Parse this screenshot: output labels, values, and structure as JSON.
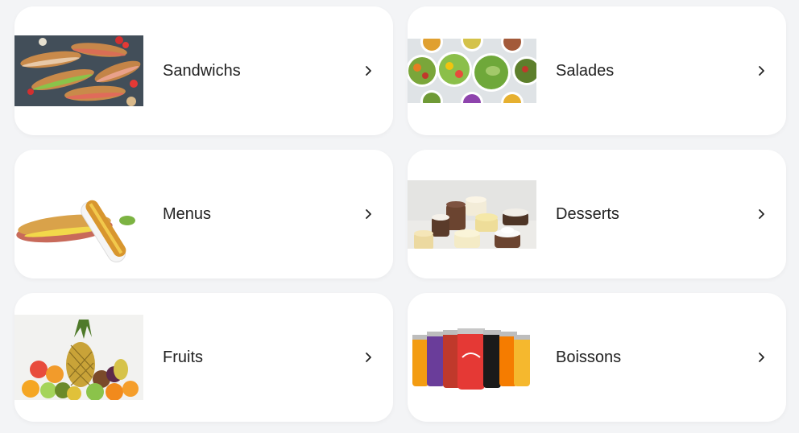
{
  "categories": [
    {
      "label": "Sandwichs",
      "image": "sandwiches-photo"
    },
    {
      "label": "Salades",
      "image": "salads-photo"
    },
    {
      "label": "Menus",
      "image": "menu-sandwich-photo"
    },
    {
      "label": "Desserts",
      "image": "desserts-photo"
    },
    {
      "label": "Fruits",
      "image": "fruits-photo"
    },
    {
      "label": "Boissons",
      "image": "drinks-photo"
    }
  ],
  "icons": {
    "chevron": "chevron-right-icon"
  },
  "colors": {
    "card_bg": "#ffffff",
    "page_bg": "#f3f4f6",
    "text": "#222222"
  }
}
